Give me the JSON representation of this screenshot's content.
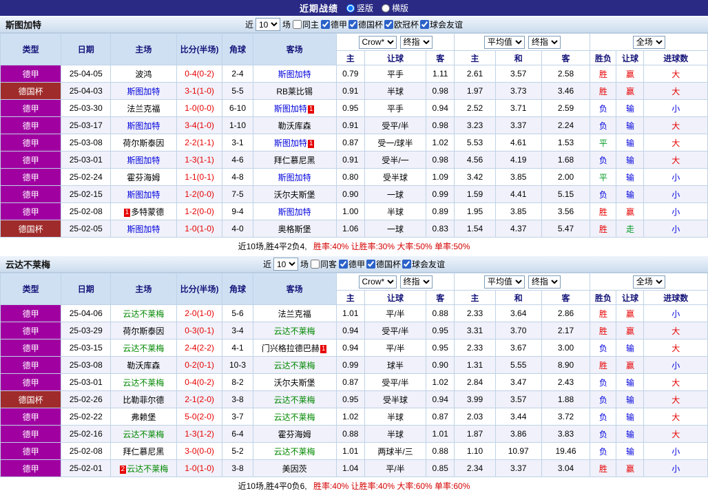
{
  "title_bar": {
    "title": "近期战绩",
    "vertical": "竖版",
    "horizontal": "横版"
  },
  "columns": {
    "type": "类型",
    "date": "日期",
    "home": "主场",
    "score": "比分(半场)",
    "corner": "角球",
    "away": "客场",
    "h_home": "主",
    "h_handicap": "让球",
    "h_away": "客",
    "e_home": "主",
    "e_draw": "和",
    "e_away": "客",
    "r_wl": "胜负",
    "r_handicap": "让球",
    "r_goals": "进球数"
  },
  "selects": {
    "bookmaker": "Crow*",
    "final_odds": "终指",
    "average": "平均值",
    "full_match": "全场"
  },
  "league_colors": {
    "德甲": "#a000a0",
    "德国杯": "#a02b2b"
  },
  "result_colors": {
    "胜": "#e60000",
    "赢": "#e60000",
    "大": "#e60000",
    "平": "#009922",
    "走": "#009922",
    "负": "#0000dd",
    "输": "#0000dd",
    "小": "#0000dd"
  },
  "sections": [
    {
      "team": "斯图加特",
      "team_color": "#0000dd",
      "filter": {
        "near_label": "近",
        "count": "10",
        "games_label": "场",
        "same_label": "同主",
        "leagues": [
          "德甲",
          "德国杯",
          "欧冠杯",
          "球会友谊"
        ]
      },
      "rows": [
        {
          "league": "德甲",
          "date": "25-04-05",
          "home": "波鸿",
          "home_badge": "",
          "score": "0-4(0-2)",
          "corner": "2-4",
          "away": "斯图加特",
          "away_badge": "",
          "ah_home": "0.79",
          "ah_line": "平手",
          "ah_away": "1.11",
          "eu_home": "2.61",
          "eu_draw": "3.57",
          "eu_away": "2.58",
          "res_outcome": "胜",
          "res_handicap": "赢",
          "res_goals": "大"
        },
        {
          "league": "德国杯",
          "date": "25-04-03",
          "home": "斯图加特",
          "home_badge": "",
          "score": "3-1(1-0)",
          "corner": "5-5",
          "away": "RB莱比锡",
          "away_badge": "",
          "ah_home": "0.91",
          "ah_line": "半球",
          "ah_away": "0.98",
          "eu_home": "1.97",
          "eu_draw": "3.73",
          "eu_away": "3.46",
          "res_outcome": "胜",
          "res_handicap": "赢",
          "res_goals": "大"
        },
        {
          "league": "德甲",
          "date": "25-03-30",
          "home": "法兰克福",
          "home_badge": "",
          "score": "1-0(0-0)",
          "corner": "6-10",
          "away": "斯图加特",
          "away_badge": "1",
          "ah_home": "0.95",
          "ah_line": "平手",
          "ah_away": "0.94",
          "eu_home": "2.52",
          "eu_draw": "3.71",
          "eu_away": "2.59",
          "res_outcome": "负",
          "res_handicap": "输",
          "res_goals": "小"
        },
        {
          "league": "德甲",
          "date": "25-03-17",
          "home": "斯图加特",
          "home_badge": "",
          "score": "3-4(1-0)",
          "corner": "1-10",
          "away": "勒沃库森",
          "away_badge": "",
          "ah_home": "0.91",
          "ah_line": "受平/半",
          "ah_away": "0.98",
          "eu_home": "3.23",
          "eu_draw": "3.37",
          "eu_away": "2.24",
          "res_outcome": "负",
          "res_handicap": "输",
          "res_goals": "大"
        },
        {
          "league": "德甲",
          "date": "25-03-08",
          "home": "荷尔斯泰因",
          "home_badge": "",
          "score": "2-2(1-1)",
          "corner": "3-1",
          "away": "斯图加特",
          "away_badge": "1",
          "ah_home": "0.87",
          "ah_line": "受一/球半",
          "ah_away": "1.02",
          "eu_home": "5.53",
          "eu_draw": "4.61",
          "eu_away": "1.53",
          "res_outcome": "平",
          "res_handicap": "输",
          "res_goals": "大"
        },
        {
          "league": "德甲",
          "date": "25-03-01",
          "home": "斯图加特",
          "home_badge": "",
          "score": "1-3(1-1)",
          "corner": "4-6",
          "away": "拜仁慕尼黑",
          "away_badge": "",
          "ah_home": "0.91",
          "ah_line": "受半/一",
          "ah_away": "0.98",
          "eu_home": "4.56",
          "eu_draw": "4.19",
          "eu_away": "1.68",
          "res_outcome": "负",
          "res_handicap": "输",
          "res_goals": "大"
        },
        {
          "league": "德甲",
          "date": "25-02-24",
          "home": "霍芬海姆",
          "home_badge": "",
          "score": "1-1(0-1)",
          "corner": "4-8",
          "away": "斯图加特",
          "away_badge": "",
          "ah_home": "0.80",
          "ah_line": "受半球",
          "ah_away": "1.09",
          "eu_home": "3.42",
          "eu_draw": "3.85",
          "eu_away": "2.00",
          "res_outcome": "平",
          "res_handicap": "输",
          "res_goals": "小"
        },
        {
          "league": "德甲",
          "date": "25-02-15",
          "home": "斯图加特",
          "home_badge": "",
          "score": "1-2(0-0)",
          "corner": "7-5",
          "away": "沃尔夫斯堡",
          "away_badge": "",
          "ah_home": "0.90",
          "ah_line": "一球",
          "ah_away": "0.99",
          "eu_home": "1.59",
          "eu_draw": "4.41",
          "eu_away": "5.15",
          "res_outcome": "负",
          "res_handicap": "输",
          "res_goals": "小"
        },
        {
          "league": "德甲",
          "date": "25-02-08",
          "home": "多特蒙德",
          "home_badge": "1",
          "score": "1-2(0-0)",
          "corner": "9-4",
          "away": "斯图加特",
          "away_badge": "",
          "ah_home": "1.00",
          "ah_line": "半球",
          "ah_away": "0.89",
          "eu_home": "1.95",
          "eu_draw": "3.85",
          "eu_away": "3.56",
          "res_outcome": "胜",
          "res_handicap": "赢",
          "res_goals": "小"
        },
        {
          "league": "德国杯",
          "date": "25-02-05",
          "home": "斯图加特",
          "home_badge": "",
          "score": "1-0(1-0)",
          "corner": "4-0",
          "away": "奥格斯堡",
          "away_badge": "",
          "ah_home": "1.06",
          "ah_line": "一球",
          "ah_away": "0.83",
          "eu_home": "1.54",
          "eu_draw": "4.37",
          "eu_away": "5.47",
          "res_outcome": "胜",
          "res_handicap": "走",
          "res_goals": "小"
        }
      ],
      "summary": {
        "record": "近10场,胜4平2负4,",
        "rates": "胜率:40% 让胜率:30% 大率:50% 单率:50%"
      }
    },
    {
      "team": "云达不莱梅",
      "team_color": "#008800",
      "filter": {
        "near_label": "近",
        "count": "10",
        "games_label": "场",
        "same_label": "同客",
        "leagues": [
          "德甲",
          "德国杯",
          "球会友谊"
        ]
      },
      "rows": [
        {
          "league": "德甲",
          "date": "25-04-06",
          "home": "云达不莱梅",
          "home_badge": "",
          "score": "2-0(1-0)",
          "corner": "5-6",
          "away": "法兰克福",
          "away_badge": "",
          "ah_home": "1.01",
          "ah_line": "平/半",
          "ah_away": "0.88",
          "eu_home": "2.33",
          "eu_draw": "3.64",
          "eu_away": "2.86",
          "res_outcome": "胜",
          "res_handicap": "赢",
          "res_goals": "小"
        },
        {
          "league": "德甲",
          "date": "25-03-29",
          "home": "荷尔斯泰因",
          "home_badge": "",
          "score": "0-3(0-1)",
          "corner": "3-4",
          "away": "云达不莱梅",
          "away_badge": "",
          "ah_home": "0.94",
          "ah_line": "受平/半",
          "ah_away": "0.95",
          "eu_home": "3.31",
          "eu_draw": "3.70",
          "eu_away": "2.17",
          "res_outcome": "胜",
          "res_handicap": "赢",
          "res_goals": "大"
        },
        {
          "league": "德甲",
          "date": "25-03-15",
          "home": "云达不莱梅",
          "home_badge": "",
          "score": "2-4(2-2)",
          "corner": "4-1",
          "away": "门兴格拉德巴赫",
          "away_badge": "1",
          "ah_home": "0.94",
          "ah_line": "平/半",
          "ah_away": "0.95",
          "eu_home": "2.33",
          "eu_draw": "3.67",
          "eu_away": "3.00",
          "res_outcome": "负",
          "res_handicap": "输",
          "res_goals": "大"
        },
        {
          "league": "德甲",
          "date": "25-03-08",
          "home": "勒沃库森",
          "home_badge": "",
          "score": "0-2(0-1)",
          "corner": "10-3",
          "away": "云达不莱梅",
          "away_badge": "",
          "ah_home": "0.99",
          "ah_line": "球半",
          "ah_away": "0.90",
          "eu_home": "1.31",
          "eu_draw": "5.55",
          "eu_away": "8.90",
          "res_outcome": "胜",
          "res_handicap": "赢",
          "res_goals": "小"
        },
        {
          "league": "德甲",
          "date": "25-03-01",
          "home": "云达不莱梅",
          "home_badge": "",
          "score": "0-4(0-2)",
          "corner": "8-2",
          "away": "沃尔夫斯堡",
          "away_badge": "",
          "ah_home": "0.87",
          "ah_line": "受平/半",
          "ah_away": "1.02",
          "eu_home": "2.84",
          "eu_draw": "3.47",
          "eu_away": "2.43",
          "res_outcome": "负",
          "res_handicap": "输",
          "res_goals": "大"
        },
        {
          "league": "德国杯",
          "date": "25-02-26",
          "home": "比勒菲尔德",
          "home_badge": "",
          "score": "2-1(2-0)",
          "corner": "3-8",
          "away": "云达不莱梅",
          "away_badge": "",
          "ah_home": "0.95",
          "ah_line": "受半球",
          "ah_away": "0.94",
          "eu_home": "3.99",
          "eu_draw": "3.57",
          "eu_away": "1.88",
          "res_outcome": "负",
          "res_handicap": "输",
          "res_goals": "大"
        },
        {
          "league": "德甲",
          "date": "25-02-22",
          "home": "弗赖堡",
          "home_badge": "",
          "score": "5-0(2-0)",
          "corner": "3-7",
          "away": "云达不莱梅",
          "away_badge": "",
          "ah_home": "1.02",
          "ah_line": "半球",
          "ah_away": "0.87",
          "eu_home": "2.03",
          "eu_draw": "3.44",
          "eu_away": "3.72",
          "res_outcome": "负",
          "res_handicap": "输",
          "res_goals": "大"
        },
        {
          "league": "德甲",
          "date": "25-02-16",
          "home": "云达不莱梅",
          "home_badge": "",
          "score": "1-3(1-2)",
          "corner": "6-4",
          "away": "霍芬海姆",
          "away_badge": "",
          "ah_home": "0.88",
          "ah_line": "半球",
          "ah_away": "1.01",
          "eu_home": "1.87",
          "eu_draw": "3.86",
          "eu_away": "3.83",
          "res_outcome": "负",
          "res_handicap": "输",
          "res_goals": "大"
        },
        {
          "league": "德甲",
          "date": "25-02-08",
          "home": "拜仁慕尼黑",
          "home_badge": "",
          "score": "3-0(0-0)",
          "corner": "5-2",
          "away": "云达不莱梅",
          "away_badge": "",
          "ah_home": "1.01",
          "ah_line": "两球半/三",
          "ah_away": "0.88",
          "eu_home": "1.10",
          "eu_draw": "10.97",
          "eu_away": "19.46",
          "res_outcome": "负",
          "res_handicap": "输",
          "res_goals": "小"
        },
        {
          "league": "德甲",
          "date": "25-02-01",
          "home": "云达不莱梅",
          "home_badge": "2",
          "score": "1-0(1-0)",
          "corner": "3-8",
          "away": "美因茨",
          "away_badge": "",
          "ah_home": "1.04",
          "ah_line": "平/半",
          "ah_away": "0.85",
          "eu_home": "2.34",
          "eu_draw": "3.37",
          "eu_away": "3.04",
          "res_outcome": "胜",
          "res_handicap": "赢",
          "res_goals": "小"
        }
      ],
      "summary": {
        "record": "近10场,胜4平0负6,",
        "rates": "胜率:40% 让胜率:40% 大率:60% 单率:60%"
      }
    }
  ]
}
